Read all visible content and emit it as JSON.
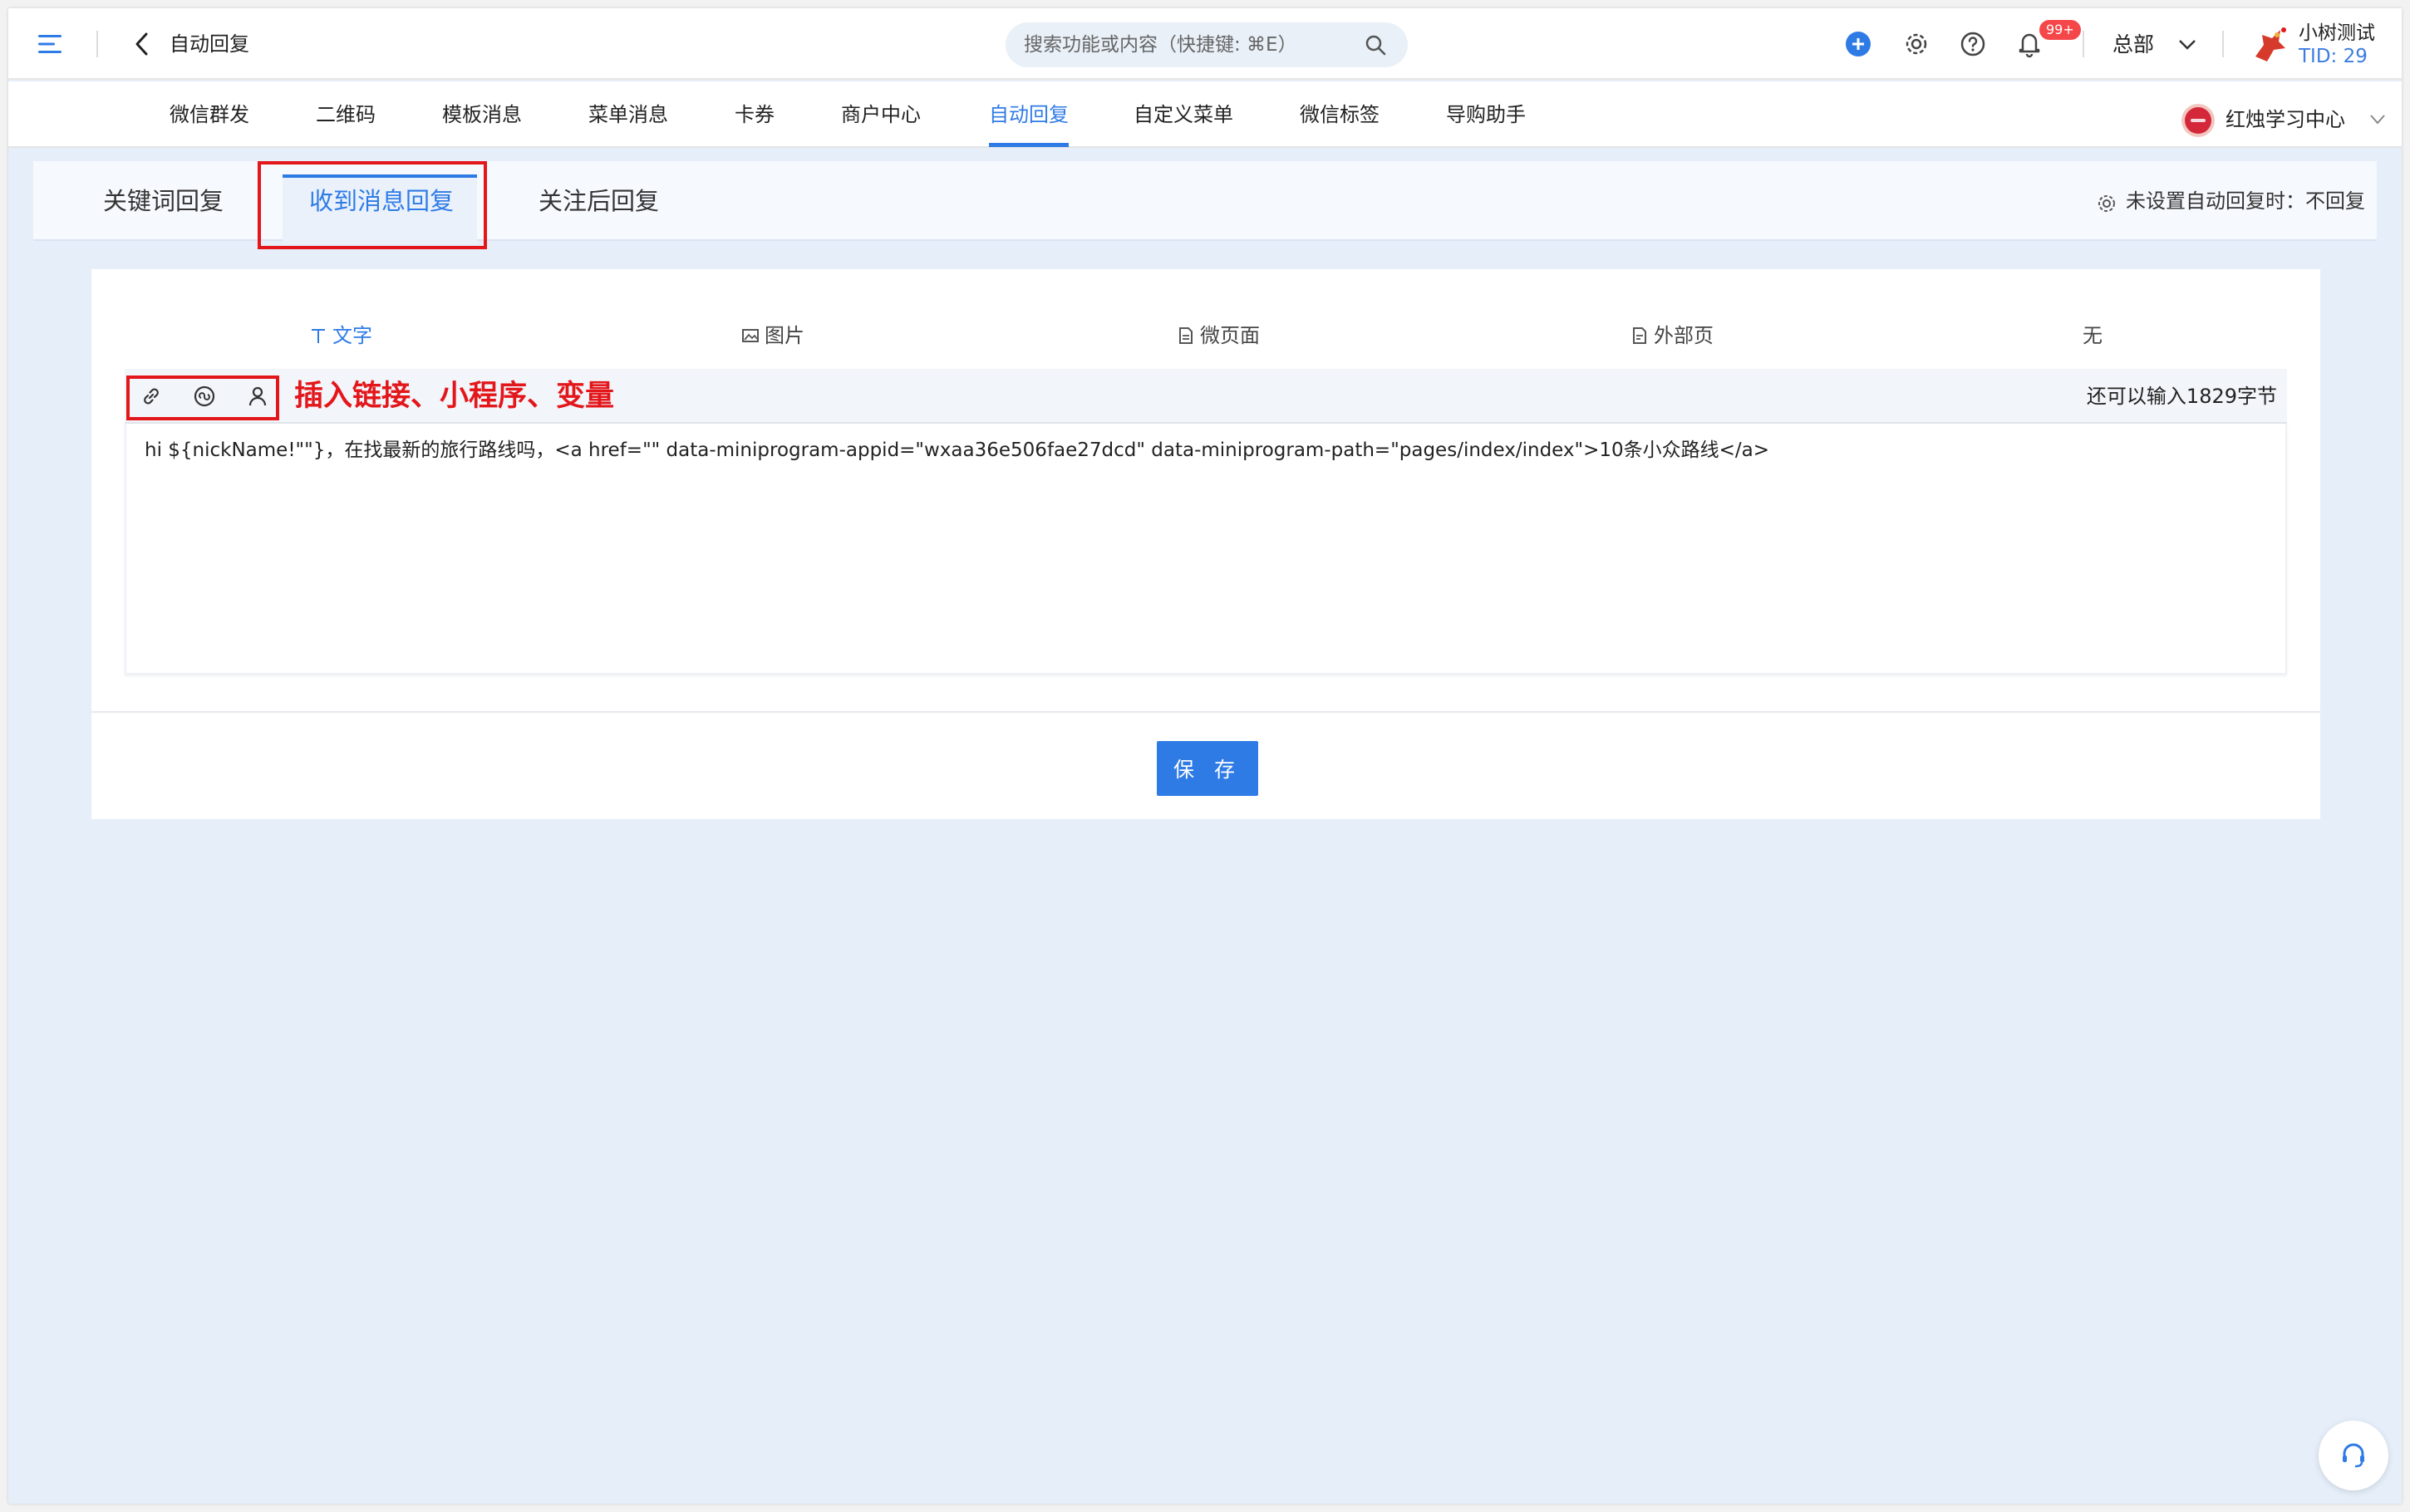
{
  "topbar": {
    "page_title": "自动回复",
    "search_placeholder": "搜索功能或内容（快捷键: ⌘E）",
    "notification_badge": "99+",
    "org_select": "总部",
    "user_name": "小树测试",
    "user_tid": "TID: 29"
  },
  "nav": {
    "items": [
      "微信群发",
      "二维码",
      "模板消息",
      "菜单消息",
      "卡券",
      "商户中心",
      "自动回复",
      "自定义菜单",
      "微信标签",
      "导购助手"
    ],
    "active": "自动回复",
    "account_name": "红烛学习中心"
  },
  "subtabs": {
    "items": [
      "关键词回复",
      "收到消息回复",
      "关注后回复"
    ],
    "active": "收到消息回复",
    "setting_text": "未设置自动回复时：不回复"
  },
  "content_types": {
    "items": [
      "文字",
      "图片",
      "微页面",
      "外部页",
      "无"
    ],
    "active": "文字"
  },
  "toolbar": {
    "tools": [
      "link-icon",
      "miniprogram-icon",
      "variable-user-icon"
    ],
    "insert_note": "插入链接、小程序、变量",
    "remaining": "还可以输入1829字节"
  },
  "editor": {
    "content": "hi ${nickName!\"\"}，在找最新的旅行路线吗，<a href=\"\" data-miniprogram-appid=\"wxaa36e506fae27dcd\" data-miniprogram-path=\"pages/index/index\">10条小众路线</a>"
  },
  "save_label": "保 存",
  "colors": {
    "accent": "#2f7be6",
    "highlight_red": "#e3171b",
    "page_bg": "#e5eef9"
  }
}
